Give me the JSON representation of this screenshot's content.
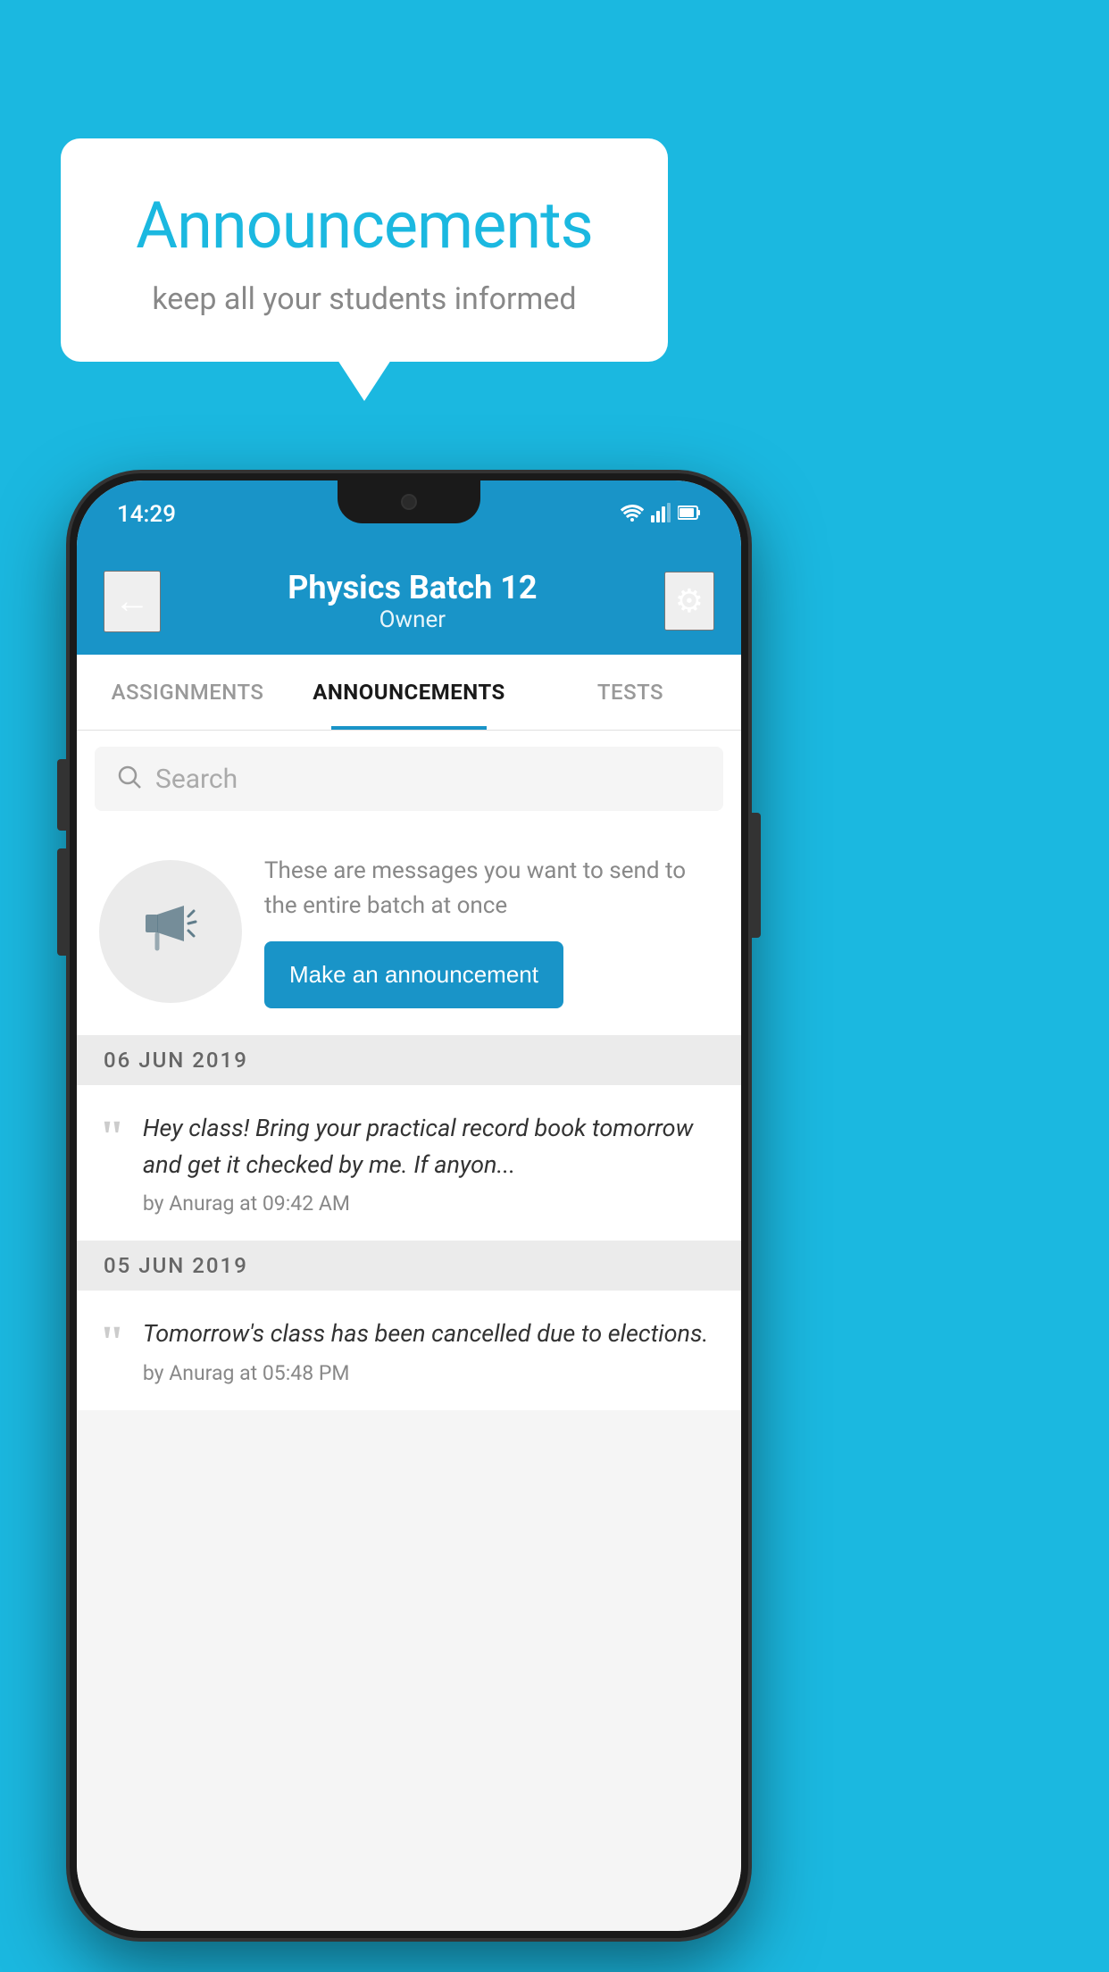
{
  "background_color": "#1bb8e0",
  "speech_bubble": {
    "title": "Announcements",
    "subtitle": "keep all your students informed"
  },
  "status_bar": {
    "time": "14:29",
    "wifi": "▼",
    "signal": "▲",
    "battery": "▐"
  },
  "app_bar": {
    "back_icon": "←",
    "title": "Physics Batch 12",
    "subtitle": "Owner",
    "settings_icon": "⚙"
  },
  "tabs": [
    {
      "label": "ASSIGNMENTS",
      "active": false
    },
    {
      "label": "ANNOUNCEMENTS",
      "active": true
    },
    {
      "label": "TESTS",
      "active": false
    }
  ],
  "search": {
    "placeholder": "Search"
  },
  "promo_card": {
    "description": "These are messages you want to send to the entire batch at once",
    "button_label": "Make an announcement"
  },
  "announcements": [
    {
      "date": "06  JUN  2019",
      "text": "Hey class! Bring your practical record book tomorrow and get it checked by me. If anyon...",
      "meta": "by Anurag at 09:42 AM"
    },
    {
      "date": "05  JUN  2019",
      "text": "Tomorrow's class has been cancelled due to elections.",
      "meta": "by Anurag at 05:48 PM"
    }
  ]
}
